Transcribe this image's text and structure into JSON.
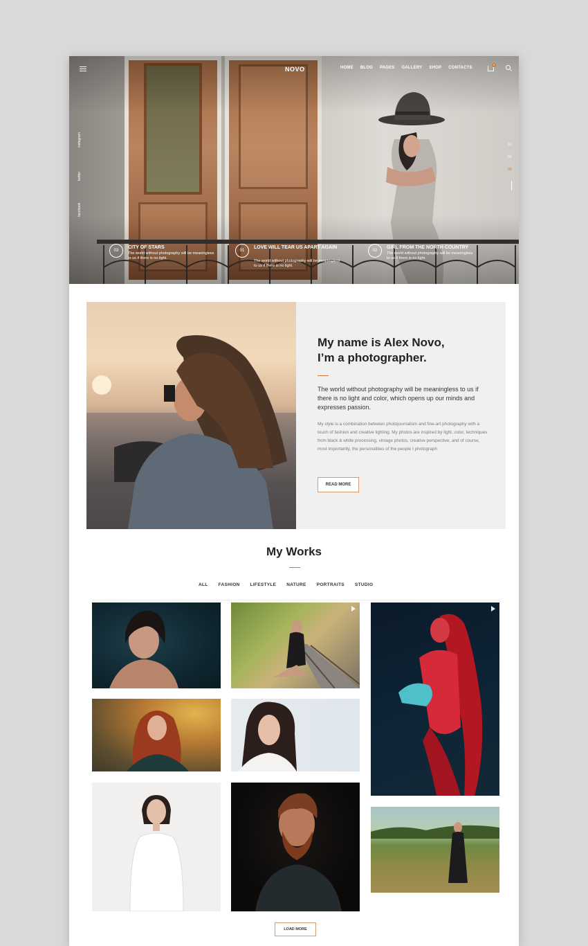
{
  "nav": {
    "logo": "NOVO",
    "items": [
      "HOME",
      "BLOG",
      "PAGES",
      "GALLERY",
      "SHOP",
      "CONTACTS"
    ],
    "active": "HOME",
    "cart_count": "0"
  },
  "social": [
    "instagram",
    "twitter",
    "facebook"
  ],
  "slider": {
    "numbers": [
      "01",
      "02",
      "03"
    ],
    "active": "03"
  },
  "captions": [
    {
      "num": "03",
      "title": "CITY OF STARS",
      "desc": "The world without photography will be meaningless to us if there is no light."
    },
    {
      "num": "01",
      "title": "LOVE WILL TEAR US APART AGAIN",
      "desc": "The world without photography will be meaningless to us if there is no light."
    },
    {
      "num": "02",
      "title": "GIRL FROM THE NORTH COUNTRY",
      "desc": "The world without photography will be meaningless to us if there is no light."
    }
  ],
  "about": {
    "title_line1": "My name is Alex Novo,",
    "title_line2": "I’m a photographer.",
    "lead": "The world without photography will be meaningless to us if there is no light and color, which opens up our minds and expresses passion.",
    "body": "My style is a combination between photojournalism and fine-art photography with a touch of fashion and creative lighting. My photos are inspired by light, color, techniques from black & white processing, vintage photos, creative perspective, and of course, most importantly, the personalities of the people I photograph",
    "read_more": "READ MORE"
  },
  "works": {
    "title": "My Works",
    "filters": [
      "ALL",
      "FASHION",
      "LIFESTYLE",
      "NATURE",
      "PORTRAITS",
      "STUDIO"
    ],
    "active_filter": "ALL",
    "load_more": "LOAD MORE"
  },
  "colors": {
    "accent": "#c97a48",
    "badge": "#d67c33"
  }
}
